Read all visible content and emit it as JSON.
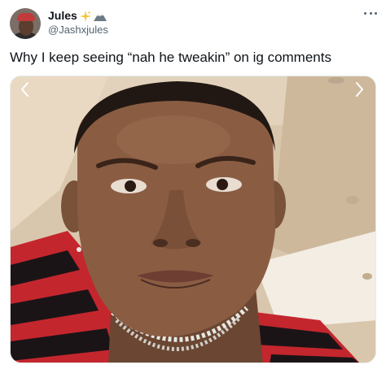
{
  "author": {
    "display_name": "Jules",
    "handle": "@Jashxjules",
    "badge_icons": [
      "sparkle-icon",
      "mountain-icon"
    ]
  },
  "tweet": {
    "text": "Why I keep seeing “nah he tweakin” on ig comments"
  },
  "media": {
    "type": "photo",
    "nav_icons": [
      "chevron-left-icon",
      "chevron-right-icon"
    ]
  },
  "colors": {
    "text_primary": "#0f1419",
    "text_secondary": "#536471",
    "sparkle": "#f4c430"
  }
}
